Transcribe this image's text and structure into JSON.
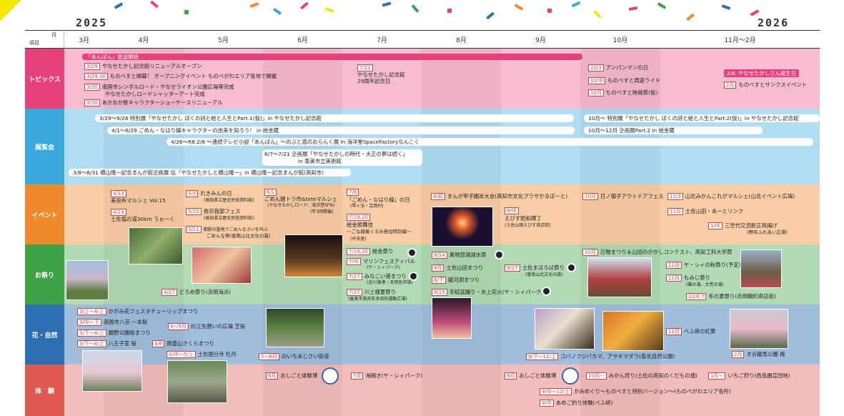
{
  "header": {
    "year_left": "2025",
    "year_right": "2026",
    "corner_top": "月",
    "corner_bottom": "項目",
    "months": [
      "3月",
      "4月",
      "5月",
      "6月",
      "7月",
      "8月",
      "9月",
      "10月",
      "11月～2月"
    ]
  },
  "rows": {
    "topics": "トピックス",
    "exhibits": "展覧会",
    "events": "イベント",
    "festivals": "お祭り",
    "nature": "花・自然",
    "experience": "体　験"
  },
  "colors": {
    "topics": "#e8407a",
    "exhibits": "#3aa9dc",
    "events": "#f08a2c",
    "festivals": "#3fa246",
    "nature": "#2e6fb4",
    "experience": "#e05a54",
    "accent_yellow": "#f7e600"
  },
  "topics": {
    "anpan_label": "「あんぱん」放送開始",
    "e1": {
      "tag": "3/29",
      "text": "やなせたかし記念館リニューアルオープン"
    },
    "e2": {
      "tag": "3/29,30",
      "text": "ものべすと開幕！ オープニングイベント ものべがわエリア各地で開催"
    },
    "e3": {
      "tag": "3/30",
      "text": "南国市シンボルロード・やなせライオン公園広場等完成"
    },
    "e3b": "やなせたかしロードシャッターアート完成",
    "e4": {
      "tag": "3/30",
      "text": "あかおか駅キャラクターショーケースリニューアル"
    },
    "e5a": "7/21",
    "e5b": "やなせたかし記念館",
    "e5c": "29周年記念日",
    "e6": {
      "tag": "10/3",
      "text": "アンパンマンの日"
    },
    "e7": {
      "tag": "10/中",
      "text": "ものべすと周遊ライド"
    },
    "e8": {
      "tag": "10月",
      "text": "ものべすと映画祭(仮)"
    },
    "e9": {
      "tag": "2/6",
      "text": "やなせたかしさん誕生日"
    },
    "e10": {
      "tag": "2月",
      "text": "ものべすとサンクスイベント"
    }
  },
  "exhibits": {
    "p1": "3/29～9/28 特別展「やなせたかし ぼくの詩と絵と人生とPart.1(仮)」in やなせたかし記念館",
    "p2": "10月～ 特別展「やなせたかし ぼくの詩と絵と人生とPart.2(仮)」in やなせたかし記念館",
    "p3": "4/1～6/29 ごめん・なはり線キャラクターの由来を知ろう！ in 絵金蔵",
    "p4": "10月～12月 企画展Part.2 in 絵金蔵",
    "p5": "4/26～R8.2/8 ～連続テレビ小説「あんぱん」～のぶと嵩のおらんく展 in 海洋堂SpaceFactoryなんこく",
    "p6a": "6/7～7/21 企画展「やなせたかしの時代・大正の夢は続く」",
    "p6b": "in 香美市立美術館",
    "p7": "3/8～8/31 横山隆一記念まんが館企画展 伝「やなせたかしと横山隆一」in 横山隆一記念まんが館(高知市)"
  },
  "events": {
    "a1": {
      "tag": "4/13",
      "text": "美良布マルシェ Vol.15"
    },
    "a2": {
      "tag": "4/19",
      "text": "土佐塩の道30km うぉーく"
    },
    "a3": {
      "tag": "5/3",
      "text": "れきみんの日"
    },
    "a3b": "(高知県立歴史民俗資料館)",
    "a4": {
      "tag": "5/10",
      "text": "長宗我部フェス"
    },
    "a4b": "(高知県立歴史民俗資料館)",
    "a5": {
      "tag": "5/11",
      "text": "御厨の聖地でごめんなさいを叫ぶ"
    },
    "a5b": "ごめんな祭(香南山北文化の森)",
    "a6": {
      "tag": "6/1",
      "text": "ごめん軽トラ市&teteマルシェ"
    },
    "a6b": "(やなせたかしロード、海洋堂SFN)",
    "a6c": "(年3回開催)",
    "a7": {
      "tag": "7/6",
      "text": ""
    },
    "a7b": "「ごめん・なはり線」の日",
    "a7c": "(琴ヶ浜・芸西村)",
    "a8": {
      "tag": "7/19,20",
      "text": ""
    },
    "a8b": "絵金歌舞伎",
    "a8c": "～ごな線着ぐるみ参加特別編～",
    "a8d": "(弁天座)",
    "a9": {
      "tag": "8/初",
      "text": "まんが甲子園本大会(高知市文化プラザかるぽーと)"
    },
    "a10": {
      "tag": "9/中",
      "text": ""
    },
    "a10b": "えびす昭和横丁",
    "a10c": "(土佐山田えびす商店街)",
    "a11": {
      "tag": "10月",
      "text": "日ノ御子アウトドアフェス"
    },
    "a12": {
      "tag": "11/3",
      "text": "山北みかんこれがマルシェ(山北イベント広場)"
    },
    "a13": {
      "tag": "11月",
      "text": "土佐山田・あーとリンク"
    },
    "a14": {
      "tag": "1/中",
      "text": "三世代交流新正凧揚げ"
    },
    "a14b": "(野市ふれあい広場)"
  },
  "festivals": {
    "f1": {
      "tag": "4/27",
      "text": "どろめ祭り(赤岡海浜)"
    },
    "f2": {
      "tag": "7/19,20",
      "text": "絵金祭り"
    },
    "f3": {
      "tag": "7/中",
      "text": "マリンフェスティバル"
    },
    "f3b": "(ヤ・シィパーク)",
    "f4": {
      "tag": "7/27",
      "text": "みなこい港まつり"
    },
    "f4b": "(吉川漁港・天然色市場)",
    "f5": {
      "tag": "7/27",
      "text": "川上様夏祭り"
    },
    "f5b": "(香美市美良布多目的運動広場)",
    "f6": {
      "tag": "8/14",
      "text": "奥物部湖湖水祭"
    },
    "f7": {
      "tag": "8月",
      "text": "土佐山田まつり"
    },
    "f8": {
      "tag": "8/下",
      "text": "龍河洞まつり"
    },
    "f9": {
      "tag": "8/15",
      "text": "手結盆踊り・水上花火(ヤ・シィパーク)"
    },
    "f10": {
      "tag": "9/27",
      "text": "土佐まほろば祭り"
    },
    "f10b": "(香南山北文化の森)",
    "f11": {
      "tag": "10月",
      "text": "刃物まつり＆山田のかかしコンテスト、高知工科大学祭"
    },
    "f12": {
      "tag": "11月",
      "text": "ヤ・シィの秋祭り(予定)"
    },
    "f13": {
      "tag": "11月",
      "text": "もみじ祭り"
    },
    "f13b": "(轟の滝、大荒の滝)",
    "f14": {
      "tag": "12/6,7",
      "text": "冬の夏祭り(赤岡鞘町商店街)"
    }
  },
  "nature": {
    "n1": {
      "tag": "3/上～4/上",
      "text": "かがみ花フェスタチューリップまつり"
    },
    "n2": {
      "tag": "3/中～下",
      "text": "南国市八京 一本桜"
    },
    "n3": {
      "tag": "3/下～4/上",
      "text": "鏡野公園桜まつり"
    },
    "n4": {
      "tag": "3/下～4/上",
      "text": "八王子宮 桜"
    },
    "n5": {
      "tag": "4～5月",
      "text": "比江先憩いの広場 芝桜"
    },
    "n6": {
      "tag": "4/6",
      "text": "岡豊山さくらまつり"
    },
    "n7": {
      "tag": "4/中～5/上",
      "text": "土佐国分寺 牡丹"
    },
    "n8": {
      "tag": "5～6月",
      "text": "のいちあじさい街道"
    },
    "n9": {
      "tag": "11月",
      "text": "べふ峡の紅葉"
    },
    "n10": {
      "tag": "9/下～11/上",
      "text": "コバノフジバカマ、アサギマダラ(香北自然公園)"
    },
    "n11": {
      "tag": "2月",
      "text": "オ谷龍馬公園 梅"
    }
  },
  "experience": {
    "x1": {
      "tag": "6月",
      "text": "おしごと体験博"
    },
    "x2": {
      "tag": "7月",
      "text": "海開き(ヤ・シィパーク)"
    },
    "x3": {
      "tag": "9月",
      "text": "おしごと体験博"
    },
    "x4": {
      "tag": "10月～",
      "text": "みかん狩り(土佐の高知のくだもの畑)"
    },
    "x5": {
      "tag": "1月～",
      "text": "いちご狩り(西島園芸団地)"
    },
    "x6": {
      "tag": "9/中～12/上",
      "text": "かみめぐり～ものべすと特別バージョン～(ものべがわエリア各所)"
    },
    "x7": {
      "tag": "9/中",
      "text": "あめご釣り体験(べふ峡)"
    }
  }
}
